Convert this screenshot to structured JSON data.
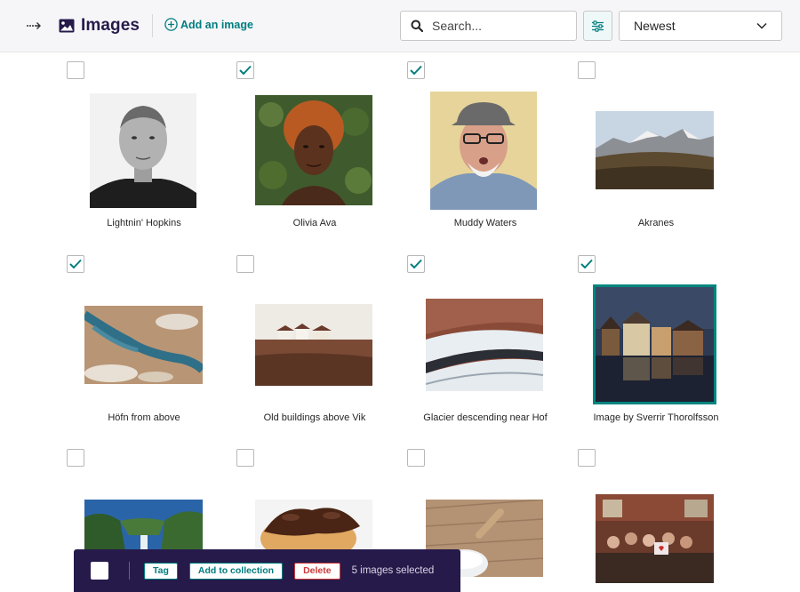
{
  "header": {
    "title": "Images",
    "add_label": "Add an image",
    "search_placeholder": "Search...",
    "sort_value": "Newest",
    "sort_options": [
      "Newest"
    ]
  },
  "images": [
    {
      "caption": "Lightnin' Hopkins",
      "checked": false,
      "selected": false
    },
    {
      "caption": "Olivia Ava",
      "checked": true,
      "selected": false
    },
    {
      "caption": "Muddy Waters",
      "checked": true,
      "selected": false
    },
    {
      "caption": "Akranes",
      "checked": false,
      "selected": false
    },
    {
      "caption": "Höfn from above",
      "checked": true,
      "selected": false
    },
    {
      "caption": "Old buildings above Vik",
      "checked": false,
      "selected": false
    },
    {
      "caption": "Glacier descending near Hof",
      "checked": true,
      "selected": false
    },
    {
      "caption": "Image by Sverrir Thorolfsson",
      "checked": true,
      "selected": true
    },
    {
      "caption": "",
      "checked": false,
      "selected": false
    },
    {
      "caption": "",
      "checked": false,
      "selected": false
    },
    {
      "caption": "",
      "checked": false,
      "selected": false
    },
    {
      "caption": "",
      "checked": false,
      "selected": false
    }
  ],
  "bulk": {
    "tag_label": "Tag",
    "collection_label": "Add to collection",
    "delete_label": "Delete",
    "status": "5 images selected"
  },
  "colors": {
    "brand": "#261a4b",
    "accent": "#007d7e",
    "danger": "#cd3a3a"
  }
}
